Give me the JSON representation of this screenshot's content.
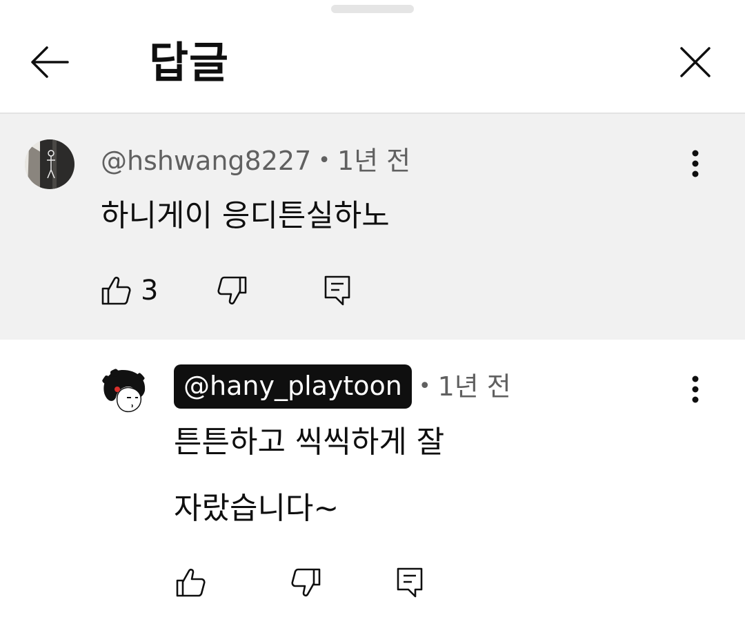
{
  "header": {
    "title": "답글",
    "back_icon": "arrow-left-icon",
    "close_icon": "close-icon"
  },
  "parent_comment": {
    "author": "@hshwang8227",
    "time": "1년 전",
    "text": "하니게이 응디튼실하노",
    "like_count": "3"
  },
  "reply": {
    "author": "@hany_playtoon",
    "time": "1년 전",
    "text_line1": "튼튼하고 씩씩하게 잘",
    "text_line2": "자랐습니다~"
  },
  "separator": "•",
  "colors": {
    "parent_bg": "#f1f1f1",
    "meta_text": "#606060",
    "badge_bg": "#0f0f0f",
    "badge_text": "#ffffff"
  }
}
